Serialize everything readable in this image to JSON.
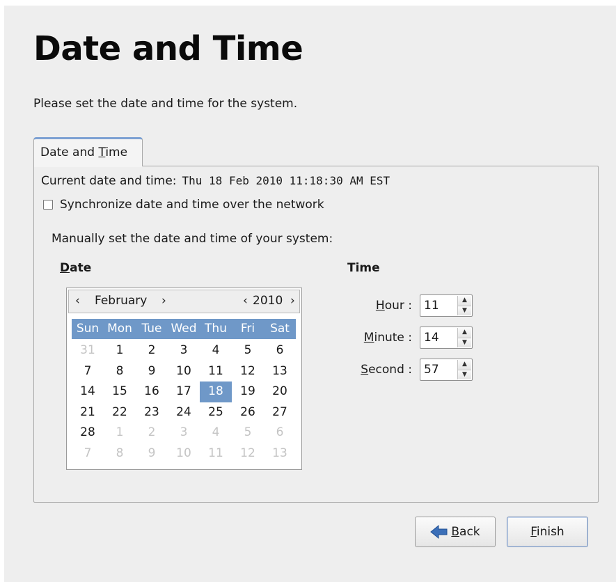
{
  "page": {
    "title": "Date and Time",
    "subtitle": "Please set the date and time for the system."
  },
  "tab": {
    "label_prefix": "Date and ",
    "label_mnemonic": "T",
    "label_rest": "ime"
  },
  "current": {
    "label": "Current date and time:",
    "value": "Thu 18 Feb 2010 11:18:30 AM EST"
  },
  "sync": {
    "label": "Synchronize date and time over the network",
    "checked": false
  },
  "manual_label": "Manually set the date and time of your system:",
  "date_section": {
    "heading_mnemonic": "D",
    "heading_rest": "ate"
  },
  "time_section": {
    "heading": "Time"
  },
  "calendar": {
    "prev_month": "‹",
    "month": "February",
    "next_month": "›",
    "prev_year": "‹",
    "year": "2010",
    "next_year": "›",
    "weekdays": [
      "Sun",
      "Mon",
      "Tue",
      "Wed",
      "Thu",
      "Fri",
      "Sat"
    ],
    "weeks": [
      [
        "31",
        "1",
        "2",
        "3",
        "4",
        "5",
        "6"
      ],
      [
        "7",
        "8",
        "9",
        "10",
        "11",
        "12",
        "13"
      ],
      [
        "14",
        "15",
        "16",
        "17",
        "18",
        "19",
        "20"
      ],
      [
        "21",
        "22",
        "23",
        "24",
        "25",
        "26",
        "27"
      ],
      [
        "28",
        "1",
        "2",
        "3",
        "4",
        "5",
        "6"
      ],
      [
        "7",
        "8",
        "9",
        "10",
        "11",
        "12",
        "13"
      ]
    ],
    "selected_day": "18",
    "accent": "#6f98c8"
  },
  "time": {
    "hour": {
      "mnemonic": "H",
      "rest": "our :",
      "value": "11"
    },
    "minute": {
      "mnemonic": "M",
      "rest": "inute :",
      "value": "14"
    },
    "second": {
      "mnemonic": "S",
      "rest": "econd :",
      "value": "57"
    }
  },
  "buttons": {
    "back": {
      "mnemonic": "B",
      "rest": "ack",
      "icon": "back-arrow-icon"
    },
    "finish": {
      "mnemonic": "F",
      "rest": "inish"
    }
  }
}
